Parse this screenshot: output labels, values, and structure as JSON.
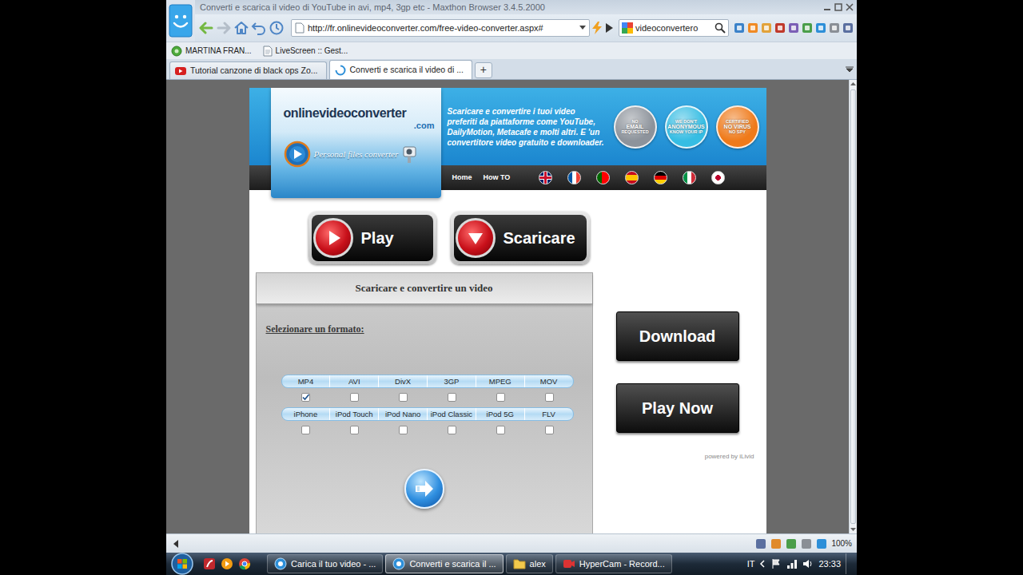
{
  "window": {
    "title": "Converti e scarica il video di YouTube in avi, mp4, 3gp etc - Maxthon Browser 3.4.5.2000"
  },
  "toolbar": {
    "address": "http://fr.onlinevideoconverter.com/free-video-converter.aspx#",
    "search": "videoconvertero"
  },
  "bookmarks": [
    {
      "label": "MARTINA FRAN...",
      "kind": "site"
    },
    {
      "label": "LiveScreen :: Gest...",
      "kind": "page"
    }
  ],
  "tabs": [
    {
      "label": "Tutorial canzone di black ops Zo...",
      "selected": false,
      "kind": "youtube"
    },
    {
      "label": "Converti e scarica il video di ...",
      "selected": true,
      "kind": "loading"
    }
  ],
  "new_tab": "+",
  "page": {
    "logo": {
      "name": "onlinevideoconverter",
      "suffix": ".com",
      "tagline": "Personal files converter"
    },
    "intro": "Scaricare e convertire i tuoi video preferiti da piattaforme come YouTube, DailyMotion, Metacafe e molti altri. E 'un convertitore video gratuito e downloader.",
    "badges": [
      {
        "top": "NO",
        "main": "EMAIL",
        "bottom": "REQUESTED",
        "color": "#8d939b"
      },
      {
        "top": "WE DON'T",
        "main": "ANONYMOUS",
        "bottom": "KNOW YOUR IP",
        "color": "#36bde3"
      },
      {
        "top": "CERTIFIED",
        "main": "NO VIRUS",
        "bottom": "NO SPY",
        "color": "#ef7a1a"
      }
    ],
    "nav": [
      "Home",
      "How TO"
    ],
    "big_buttons": [
      {
        "label": "Play",
        "kind": "play"
      },
      {
        "label": "Scaricare",
        "kind": "download"
      }
    ],
    "panel": {
      "title": "Scaricare e convertire un video",
      "prompt": "Selezionare un formato:",
      "format_rows": [
        [
          {
            "label": "MP4",
            "checked": true
          },
          {
            "label": "AVI",
            "checked": false
          },
          {
            "label": "DivX",
            "checked": false
          },
          {
            "label": "3GP",
            "checked": false
          },
          {
            "label": "MPEG",
            "checked": false
          },
          {
            "label": "MOV",
            "checked": false
          }
        ],
        [
          {
            "label": "iPhone",
            "checked": false
          },
          {
            "label": "iPod Touch",
            "checked": false
          },
          {
            "label": "iPod Nano",
            "checked": false
          },
          {
            "label": "iPod Classic",
            "checked": false
          },
          {
            "label": "iPod 5G",
            "checked": false
          },
          {
            "label": "FLV",
            "checked": false
          }
        ]
      ]
    },
    "side_buttons": [
      "Download",
      "Play Now"
    ],
    "powered_by": "powered by iLivid"
  },
  "status_bar": {
    "zoom": "100%"
  },
  "taskbar": {
    "tasks": [
      {
        "label": "Carica il tuo video - ...",
        "selected": false,
        "kind": "browser"
      },
      {
        "label": "Converti e scarica il ...",
        "selected": true,
        "kind": "browser"
      },
      {
        "label": "alex",
        "selected": false,
        "kind": "folder"
      },
      {
        "label": "HyperCam - Record...",
        "selected": false,
        "kind": "recorder"
      }
    ],
    "language": "IT",
    "clock": "23:33"
  }
}
